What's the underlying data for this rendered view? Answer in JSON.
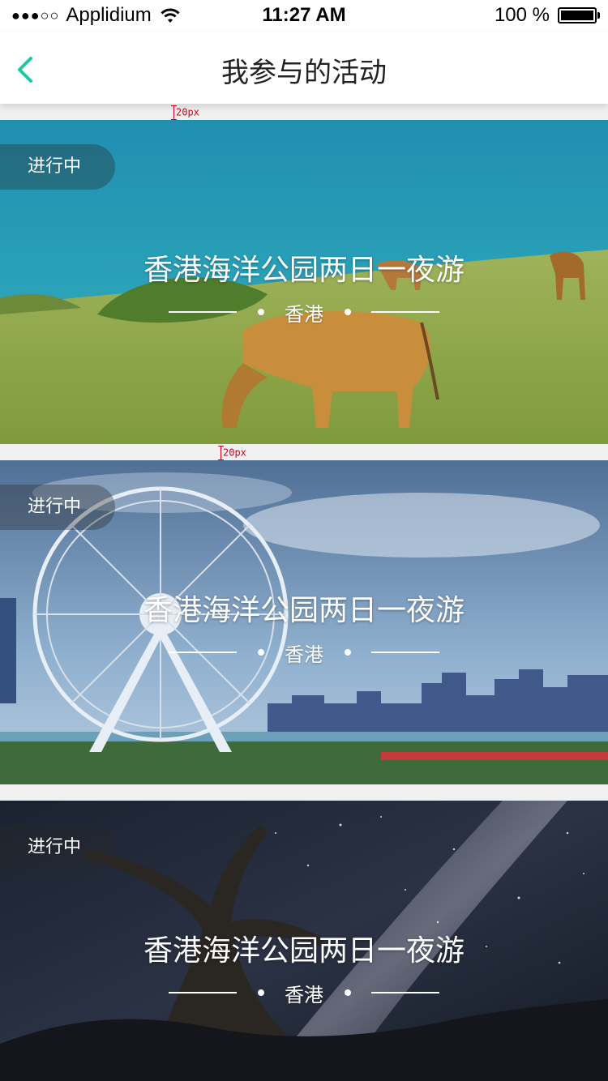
{
  "status_bar": {
    "carrier": "Applidium",
    "signal_dots": "●●●○○",
    "time": "11:27 AM",
    "battery": "100 %",
    "battery_level": 1.0
  },
  "nav": {
    "title": "我参与的活动",
    "back_icon": "chevron-left-icon",
    "accent_color": "#1ec7a0"
  },
  "annotations": {
    "gap_1": "20px",
    "gap_2": "20px"
  },
  "activities": [
    {
      "status": "进行中",
      "title": "香港海洋公园两日一夜游",
      "location": "香港",
      "image": "grassland-cow-sea-photo"
    },
    {
      "status": "进行中",
      "title": "香港海洋公园两日一夜游",
      "location": "香港",
      "image": "ferris-wheel-harbour-photo"
    },
    {
      "status": "进行中",
      "title": "香港海洋公园两日一夜游",
      "location": "香港",
      "image": "starry-night-tree-photo"
    }
  ]
}
